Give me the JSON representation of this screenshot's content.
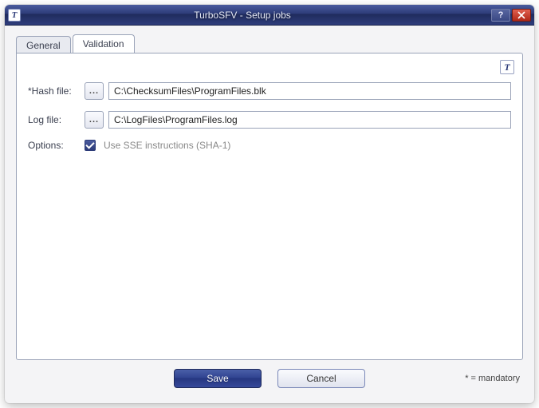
{
  "window": {
    "title": "TurboSFV - Setup jobs",
    "app_icon_letter": "T"
  },
  "tabs": {
    "general": "General",
    "validation": "Validation",
    "active": "validation"
  },
  "panel": {
    "corner_icon_letter": "T",
    "hash_file": {
      "label": "*Hash file:",
      "value": "C:\\ChecksumFiles\\ProgramFiles.blk",
      "browse": "..."
    },
    "log_file": {
      "label": "Log file:",
      "value": "C:\\LogFiles\\ProgramFiles.log",
      "browse": "..."
    },
    "options": {
      "label": "Options:",
      "use_sse_label": "Use SSE instructions (SHA-1)",
      "use_sse_checked": true
    }
  },
  "footer": {
    "save": "Save",
    "cancel": "Cancel",
    "mandatory_note": "* = mandatory"
  }
}
